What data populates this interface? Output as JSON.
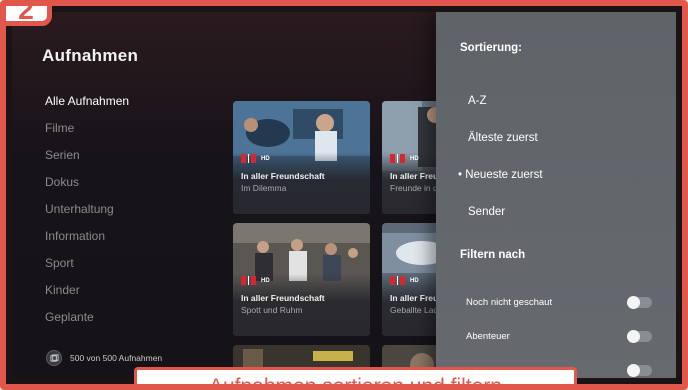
{
  "step": "2",
  "page_title": "Aufnahmen",
  "nav": [
    {
      "label": "Alle Aufnahmen",
      "active": true
    },
    {
      "label": "Filme"
    },
    {
      "label": "Serien"
    },
    {
      "label": "Dokus"
    },
    {
      "label": "Unterhaltung"
    },
    {
      "label": "Information"
    },
    {
      "label": "Sport"
    },
    {
      "label": "Kinder"
    },
    {
      "label": "Geplante"
    }
  ],
  "recording_count": "500 von 500 Aufnahmen",
  "cards": [
    {
      "channel": "HD",
      "title": "In aller Freundschaft",
      "subtitle": "Im Dilemma"
    },
    {
      "channel": "HD",
      "title": "In aller Freundschaft",
      "subtitle": "Freunde in der"
    },
    {
      "channel": "HD",
      "title": "In aller Freundschaft",
      "subtitle": "Spott und Ruhm"
    },
    {
      "channel": "HD",
      "title": "In aller Freundschaft",
      "subtitle": "Geballte Ladung"
    }
  ],
  "panel": {
    "sort_heading": "Sortierung:",
    "sort_options": [
      "A-Z",
      "Älteste zuerst",
      "• Neueste zuerst",
      "Sender"
    ],
    "filter_heading": "Filtern nach",
    "filters": [
      {
        "label": "Noch nicht geschaut",
        "on": false
      },
      {
        "label": "Abenteuer",
        "on": false
      },
      {
        "label": "",
        "on": false
      }
    ]
  },
  "caption": "Aufnahmen sortieren und filtern",
  "colors": {
    "accent": "#e2574c",
    "panel": "#64686d",
    "channel_red": "#d8262e"
  }
}
